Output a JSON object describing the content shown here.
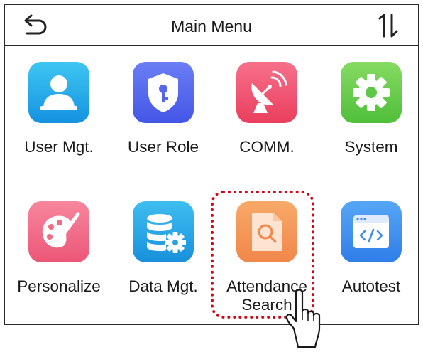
{
  "header": {
    "title": "Main Menu",
    "back_icon": "back-arrow-icon",
    "sort_icon": "sort-updown-icon"
  },
  "menu": {
    "items": [
      {
        "label": "User Mgt.",
        "icon": "user-icon",
        "color": "#1ea6ea"
      },
      {
        "label": "User Role",
        "icon": "shield-key-icon",
        "color": "#5d6ff0"
      },
      {
        "label": "COMM.",
        "icon": "satellite-dish-icon",
        "color": "#f25670"
      },
      {
        "label": "System",
        "icon": "gear-icon",
        "color": "#6ecf4e"
      },
      {
        "label": "Personalize",
        "icon": "palette-icon",
        "color": "#f26b86"
      },
      {
        "label": "Data Mgt.",
        "icon": "database-gear-icon",
        "color": "#24a6e6"
      },
      {
        "label": "Attendance\nSearch",
        "icon": "document-search-icon",
        "color": "#f59a5a"
      },
      {
        "label": "Autotest",
        "icon": "code-window-icon",
        "color": "#3d8df0"
      }
    ]
  },
  "annotation": {
    "highlight_color": "#cc0a16",
    "pointer_icon": "pointing-hand-icon"
  }
}
